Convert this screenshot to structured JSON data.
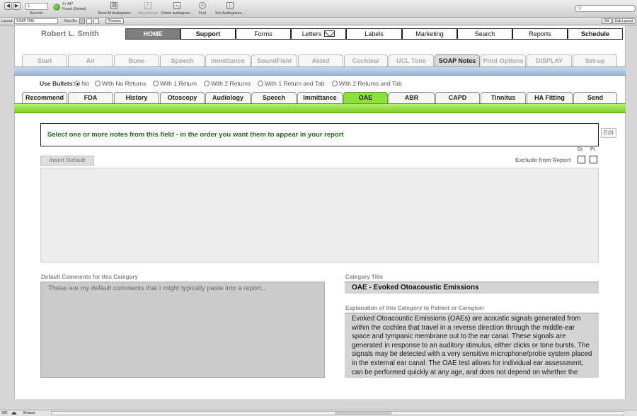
{
  "toolbar": {
    "prev_arrow": "◀",
    "next_arrow": "▶",
    "record_number": "1",
    "records_label": "Records",
    "found_count": "3 / 447",
    "found_status": "Found (Sorted)",
    "show_all": "Show All Audiograms",
    "new_record": "New Record",
    "delete": "Delete Audiogram...",
    "find": "Find",
    "sort": "Sort Audiograms...",
    "search_placeholder": "Q"
  },
  "layout_bar": {
    "layout_label": "Layout:",
    "layout_value": "SOAP OAE",
    "view_as": "View As:",
    "preview": "Preview",
    "aa": "AA",
    "edit_layout": "Edit Layout"
  },
  "patient_name": "Robert L. Smith",
  "main_nav": [
    "HOME",
    "Support",
    "Forms",
    "Letters",
    "Labels",
    "Marketing",
    "Search",
    "Reports",
    "Schedule"
  ],
  "function_tabs": [
    "Start",
    "Air",
    "Bone",
    "Speech",
    "Immittance",
    "SoundField",
    "Aided",
    "Cochlear",
    "UCL Tone",
    "SOAP Notes",
    "Print Options",
    "DISPLAY",
    "Set-up"
  ],
  "active_function_tab": "SOAP Notes",
  "bullets": {
    "label": "Use Bullets:",
    "options": [
      "No",
      "With No Returns",
      "With 1 Return",
      "With 2 Returns",
      "With 1 Return and Tab",
      "With 2 Returns and Tab"
    ],
    "selected": "No"
  },
  "soap_tabs": [
    "Recommend",
    "FDA",
    "History",
    "Otoscopy",
    "Audiology",
    "Speech",
    "Immittance",
    "OAE",
    "ABR",
    "CAPD",
    "Tinnitus",
    "HA Fitting",
    "Send"
  ],
  "active_soap_tab": "OAE",
  "instruction": "Select one or more notes from this field -  in the order you want them to appear in your report",
  "edit_label": "Edit",
  "insert_default_label": "Insert Default",
  "exclude_label": "Exclude from Report",
  "dr_label": "Dr.",
  "pt_label": "Pt.",
  "notes_value": "",
  "default_comments_label": "Default Comments for this Category",
  "default_comments_value": "These are my default comments that I might typically paste into a report...",
  "category_title_label": "Category Title",
  "category_title_value": "OAE - Evoked Otoacoustic Emissions",
  "explanation_label": "Explanation of this Category to Patient or Caregiver",
  "explanation_lines": [
    "Evoked Otoacoustic Emissions (OAEs) are acoustic signals generated from",
    "within the cochlea that travel in a reverse direction through the middle-ear",
    "space and tympanic membrane out to the ear canal. These signals are",
    "generated in response to an auditory stimulus, either clicks or tone bursts. The",
    "signals may be detected with a very sensitive microphone/probe system placed",
    "in the external ear canal. The OAE test allows for individual ear assessment,",
    "can be performed quickly at any age, and does not depend on whether the"
  ],
  "status_bar": {
    "zoom": "200",
    "mode": "Browse"
  }
}
